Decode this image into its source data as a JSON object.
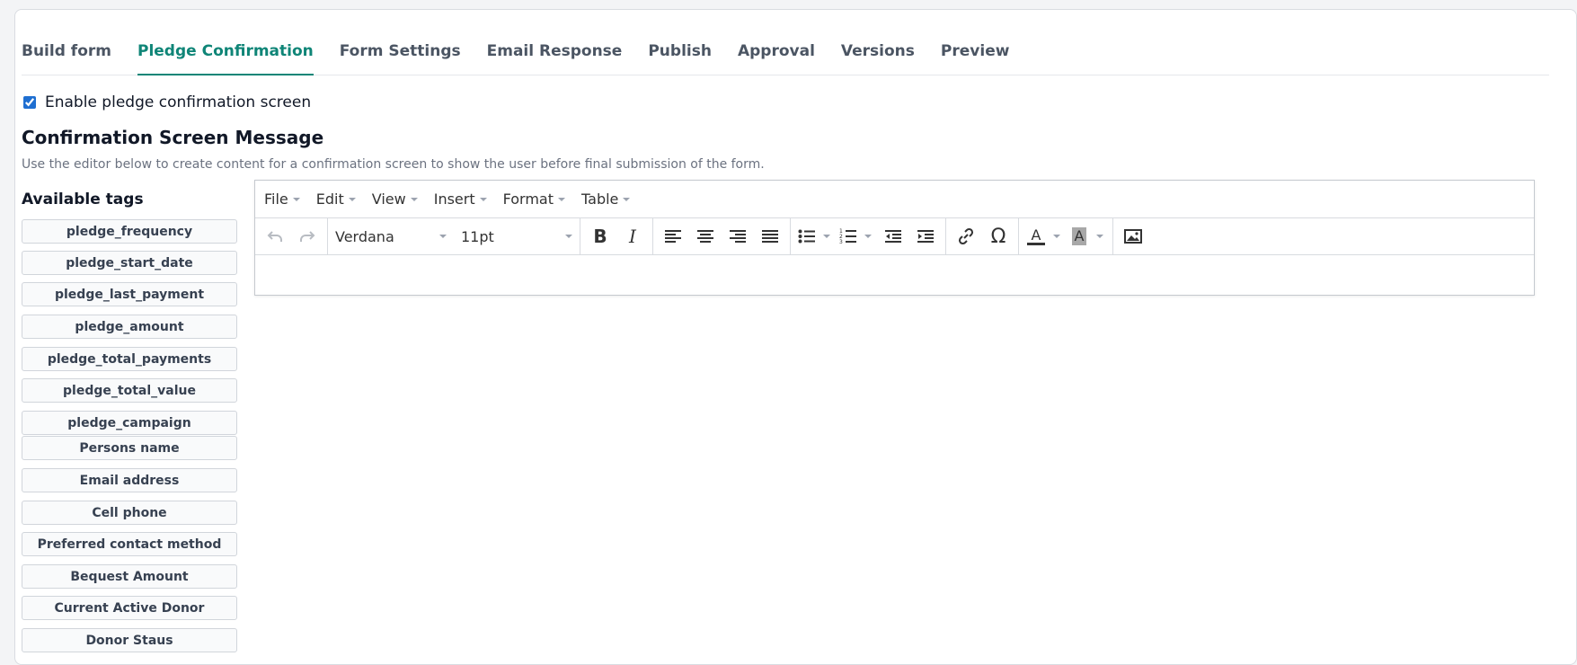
{
  "tabs": [
    {
      "label": "Build form",
      "active": false
    },
    {
      "label": "Pledge Confirmation",
      "active": true
    },
    {
      "label": "Form Settings",
      "active": false
    },
    {
      "label": "Email Response",
      "active": false
    },
    {
      "label": "Publish",
      "active": false
    },
    {
      "label": "Approval",
      "active": false
    },
    {
      "label": "Versions",
      "active": false
    },
    {
      "label": "Preview",
      "active": false
    }
  ],
  "enable_checkbox": {
    "label": "Enable pledge confirmation screen",
    "checked": true
  },
  "section": {
    "title": "Confirmation Screen Message",
    "description": "Use the editor below to create content for a confirmation screen to show the user before final submission of the form."
  },
  "tags": {
    "title": "Available tags",
    "items": [
      "pledge_frequency",
      "pledge_start_date",
      "pledge_last_payment",
      "pledge_amount",
      "pledge_total_payments",
      "pledge_total_value",
      "pledge_campaign",
      "Persons name",
      "Email address",
      "Cell phone",
      "Preferred contact method",
      "Bequest Amount",
      "Current Active Donor",
      "Donor Staus"
    ]
  },
  "editor": {
    "menus": [
      "File",
      "Edit",
      "View",
      "Insert",
      "Format",
      "Table"
    ],
    "font_family": "Verdana",
    "font_size": "11pt",
    "icons": {
      "undo": "undo-icon",
      "redo": "redo-icon",
      "bold": "bold-icon",
      "italic": "italic-icon",
      "align_left": "align-left-icon",
      "align_center": "align-center-icon",
      "align_right": "align-right-icon",
      "align_justify": "align-justify-icon",
      "bullet_list": "bullet-list-icon",
      "numbered_list": "numbered-list-icon",
      "outdent": "outdent-icon",
      "indent": "indent-icon",
      "link": "link-icon",
      "special_char": "omega-icon",
      "text_color": "text-color-icon",
      "bg_color": "background-color-icon",
      "image": "image-icon"
    },
    "toolbar_glyphs": {
      "bold": "B",
      "italic": "I",
      "special_char": "Ω",
      "text_color": "A",
      "bg_color": "A"
    }
  },
  "colors": {
    "accent": "#0f8577",
    "checkbox": "#1f6fd1"
  }
}
